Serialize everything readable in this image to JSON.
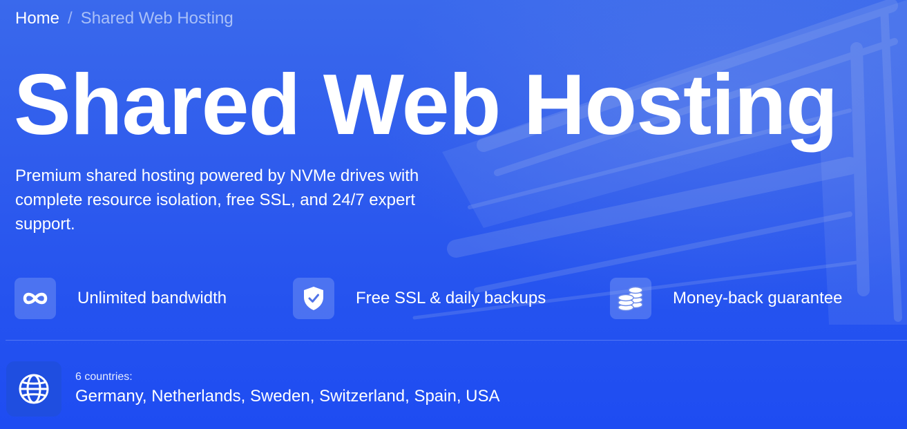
{
  "breadcrumb": {
    "home_label": "Home",
    "separator": "/",
    "current_label": "Shared Web Hosting"
  },
  "hero": {
    "title": "Shared Web Hosting",
    "subtitle": "Premium shared hosting powered by NVMe drives with complete resource isolation, free SSL, and 24/7 expert support."
  },
  "features": [
    {
      "icon": "infinity-icon",
      "label": "Unlimited bandwidth"
    },
    {
      "icon": "shield-check-icon",
      "label": "Free SSL & daily backups"
    },
    {
      "icon": "coins-icon",
      "label": "Money-back guarantee"
    }
  ],
  "locations": {
    "icon": "globe-icon",
    "count_label": "6 countries:",
    "list": "Germany, Netherlands, Sweden, Switzerland, Spain, USA"
  },
  "colors": {
    "background": "#2a55ee",
    "text": "#ffffff",
    "breadcrumb_current": "#a9c0f8",
    "icon_tile": "#8fa9f2"
  }
}
